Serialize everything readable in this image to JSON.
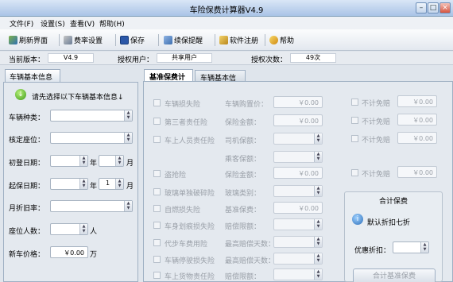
{
  "window": {
    "title": "车险保费计算器V4.9"
  },
  "menu": [
    "文件(F)",
    "设置(S)",
    "查看(V)",
    "帮助(H)"
  ],
  "toolbar": [
    {
      "label": "刷新界面",
      "icon": "refresh-icon"
    },
    {
      "label": "费率设置",
      "icon": "tools-icon"
    },
    {
      "label": "保存",
      "icon": "save-icon"
    },
    {
      "label": "续保提醒",
      "icon": "reminder-icon"
    },
    {
      "label": "软件注册",
      "icon": "register-icon"
    },
    {
      "label": "帮助",
      "icon": "help-icon"
    }
  ],
  "status": {
    "version_label": "当前版本：",
    "version": "V4.9",
    "user_label": "授权用户：",
    "user": "共享用户",
    "count_label": "授权次数：",
    "count": "49次"
  },
  "left_panel": {
    "tab": "车辆基本信息",
    "prompt": "请先选择以下车辆基本信息↓",
    "fields": {
      "vehicle_type": "车辆种类：",
      "seats": "核定座位：",
      "first_reg": "初登日期：",
      "start_date": "起保日期：",
      "depreciation": "月折旧率：",
      "seat_count": "座位人数：",
      "price": "新车价格："
    },
    "year": "年",
    "month": "月",
    "start_month_value": "1",
    "people_unit": "人",
    "price_value": "￥0.00",
    "price_unit": "万"
  },
  "right_panel": {
    "tabs": [
      "基准保费计算",
      "车辆基本信息"
    ],
    "insurances": [
      "车辆损失险",
      "第三者责任险",
      "车上人员责任险",
      "",
      "盗抢险",
      "玻璃单独破碎险",
      "自燃损失险",
      "车身划痕损失险",
      "代步车费用险",
      "车辆停驶损失险",
      "车上货物责任险"
    ],
    "fields": [
      "车辆购置价：",
      "保险金额：",
      "司机保额：",
      "乘客保额：",
      "保险金额：",
      "玻璃类别：",
      "基准保费：",
      "赔偿限额：",
      "最高赔偿天数：",
      "最高赔偿天数：",
      "赔偿限额："
    ],
    "zero": "￥0.00",
    "no_deductible": "不计免赔",
    "summary": {
      "title": "合计保费",
      "discount_note": "默认折扣七折",
      "discount_label": "优惠折扣：",
      "button": "合计基准保费"
    }
  }
}
